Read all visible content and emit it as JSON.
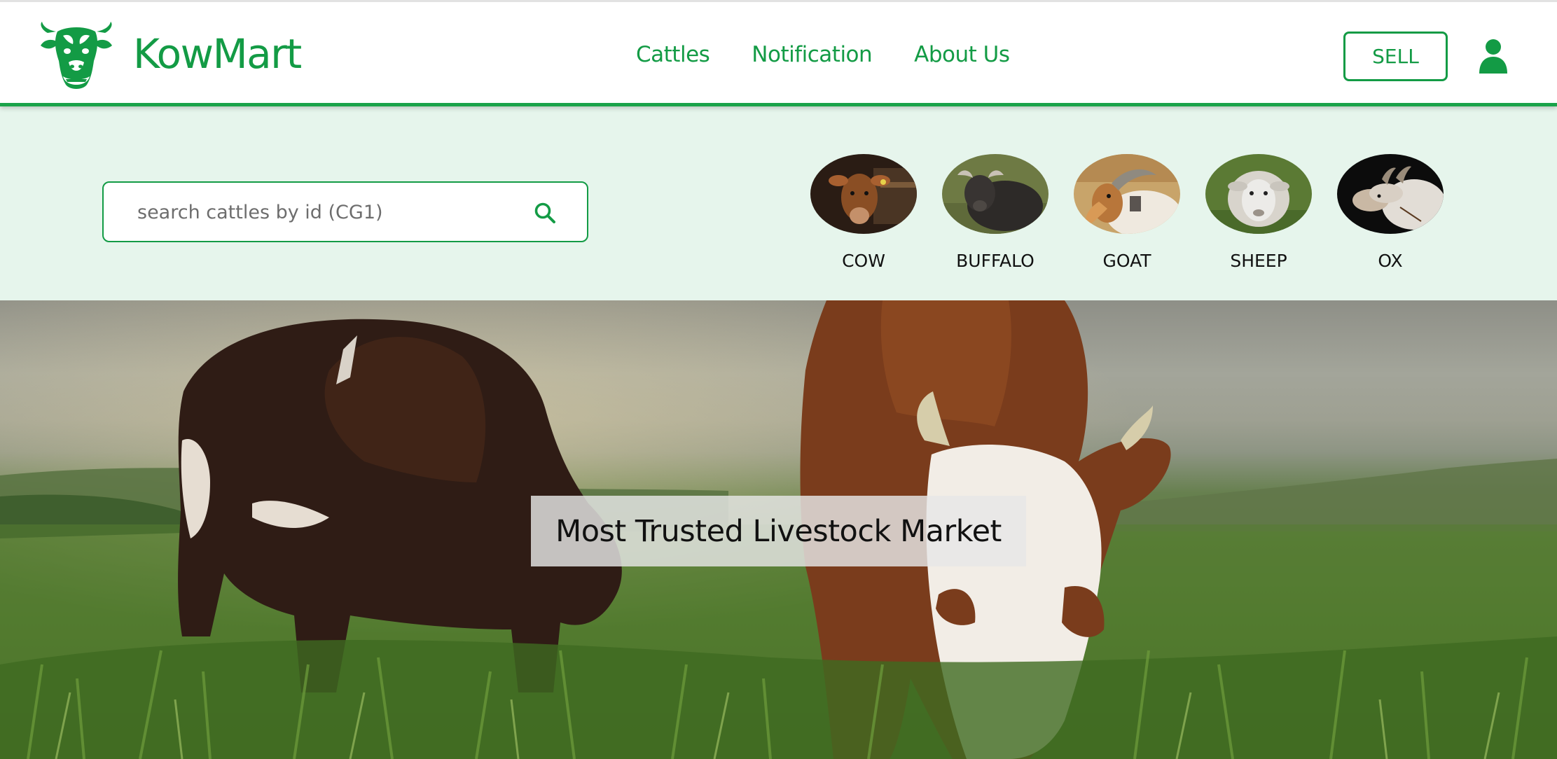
{
  "header": {
    "brand": "KowMart",
    "logo_icon": "cow-head-icon",
    "nav": [
      "Cattles",
      "Notification",
      "About Us"
    ],
    "sell_label": "SELL",
    "user_icon": "user-icon",
    "accent_color": "#139b45"
  },
  "search": {
    "placeholder": "search cattles by id (CG1)",
    "value": "",
    "icon": "search-icon"
  },
  "categories": [
    {
      "label": "COW",
      "icon": "cow-photo"
    },
    {
      "label": "BUFFALO",
      "icon": "buffalo-photo"
    },
    {
      "label": "GOAT",
      "icon": "goat-photo"
    },
    {
      "label": "SHEEP",
      "icon": "sheep-photo"
    },
    {
      "label": "OX",
      "icon": "ox-photo"
    }
  ],
  "hero": {
    "caption": "Most Trusted Livestock Market",
    "image": "grazing-cows-photo"
  },
  "colors": {
    "band_background": "#e6f5ec",
    "header_border": "#1aa34a"
  }
}
